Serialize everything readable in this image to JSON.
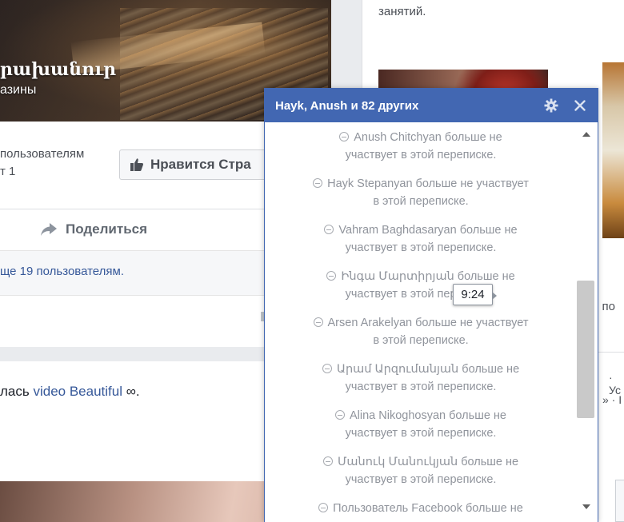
{
  "page": {
    "cover_title": "րախանուր",
    "cover_subtitle": "азины",
    "likes_text": "пользователям\nт 1",
    "like_page_button": "Нравится Стра",
    "share_label": "Поделиться",
    "others_text": "ще 19 пользователям.",
    "post_text_prefix": "лась ",
    "post_link": "video Beautiful",
    "post_text_suffix": " ∞."
  },
  "right_column": {
    "top_text": "занятий.",
    "side_text_1": "о по",
    "side_text_2": "· Ус",
    "side_text_3": "» · I"
  },
  "chat": {
    "title": "Hayk, Anush и 82 других",
    "messages": [
      {
        "line1": "Anush Chitchyan больше не",
        "line2": "участвует в этой переписке."
      },
      {
        "line1": "Hayk Stepanyan больше не участвует",
        "line2": "в этой переписке."
      },
      {
        "line1": "Vahram Baghdasaryan больше не",
        "line2": "участвует в этой переписке."
      },
      {
        "line1": "Ինգա Մարտիրյան больше не",
        "line2": "участвует в этой переписке."
      },
      {
        "line1": "Arsen Arakelyan больше не участвует",
        "line2": "в этой переписке."
      },
      {
        "line1": "Արամ Արզումանյան больше не",
        "line2": "участвует в этой переписке."
      },
      {
        "line1": "Alina Nikoghosyan больше не",
        "line2": "участвует в этой переписке."
      },
      {
        "line1": "Մանուկ Մանուկյան больше не",
        "line2": "участвует в этой переписке."
      },
      {
        "line1": "Пользователь Facebook больше не",
        "line2": ""
      }
    ],
    "timestamp_tooltip": "9:24"
  },
  "colors": {
    "chat_header": "#4267b2",
    "link": "#365899",
    "muted_text": "#90949c"
  }
}
